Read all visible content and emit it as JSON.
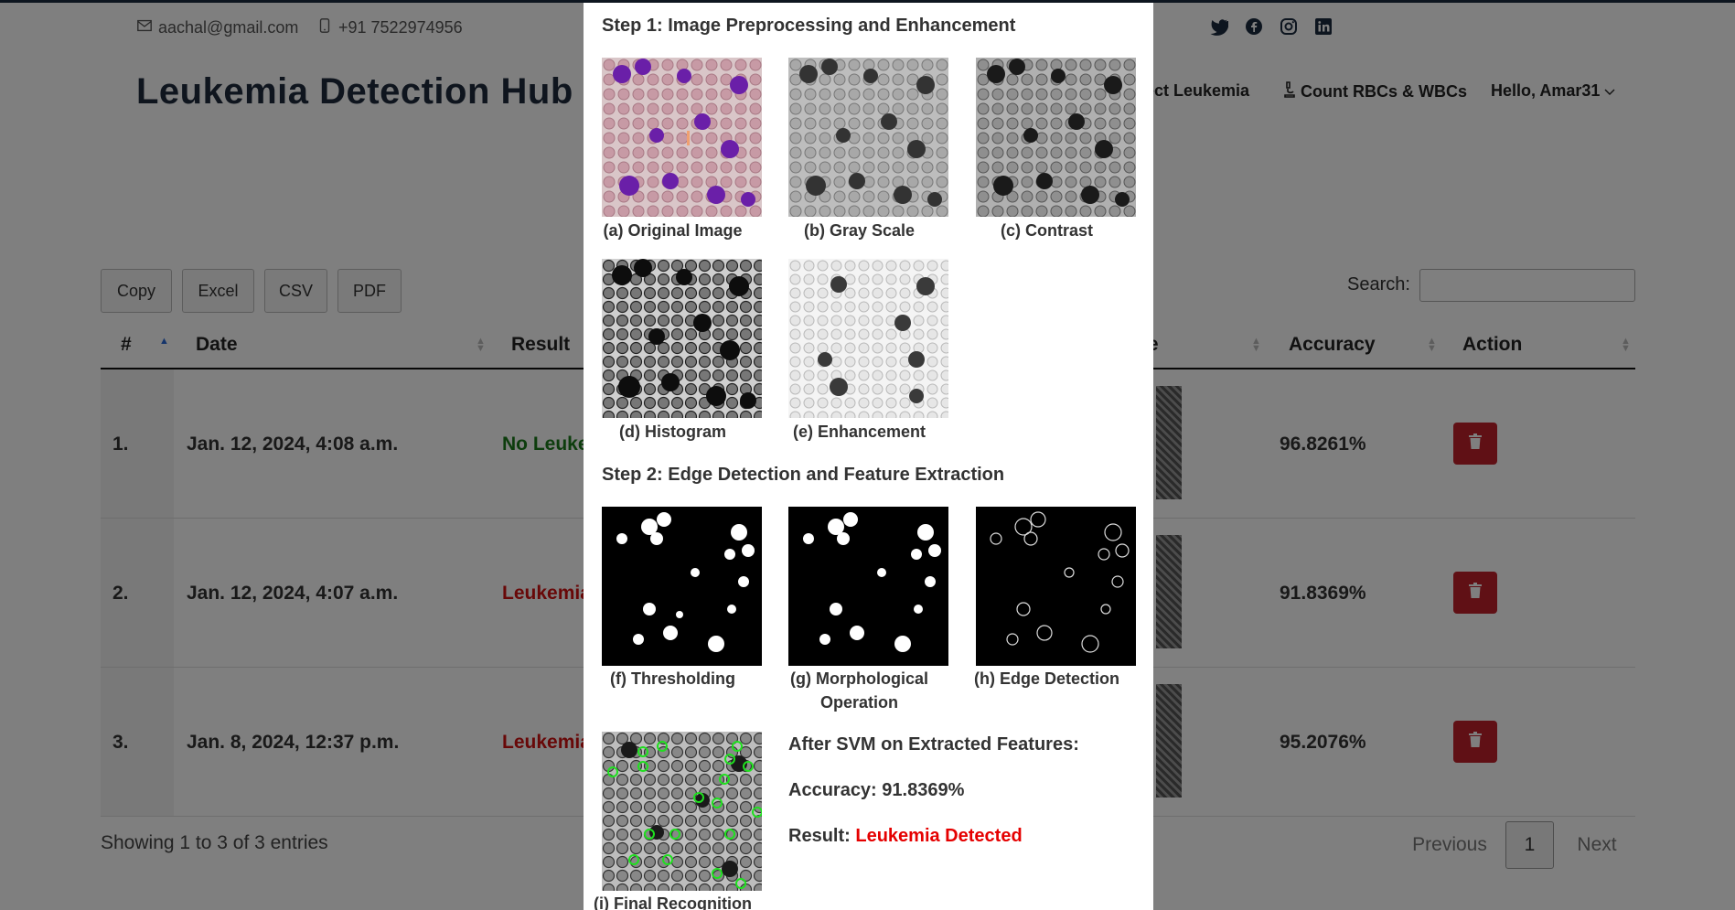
{
  "topbar": {
    "email": "aachal@gmail.com",
    "phone": "+91 7522974956",
    "social_icons": [
      "twitter-icon",
      "facebook-icon",
      "instagram-icon",
      "linkedin-icon"
    ]
  },
  "navbar": {
    "brand": "Leukemia Detection Hub",
    "items": [
      {
        "label": "ect Leukemia"
      },
      {
        "label": "Count RBCs & WBCs"
      },
      {
        "label": "Hello, Amar31"
      }
    ]
  },
  "table_controls": {
    "export_buttons": [
      "Copy",
      "Excel",
      "CSV",
      "PDF"
    ],
    "search_label": "Search:",
    "search_value": ""
  },
  "table": {
    "headers": [
      "#",
      "Date",
      "Result",
      "ge",
      "Accuracy",
      "Action"
    ],
    "rows": [
      {
        "num": "1.",
        "date": "Jan. 12, 2024, 4:08 a.m.",
        "result": "No Leuke",
        "result_color": "#1a7a1a",
        "accuracy": "96.8261%"
      },
      {
        "num": "2.",
        "date": "Jan. 12, 2024, 4:07 a.m.",
        "result": "Leukemia",
        "result_color": "#d01010",
        "accuracy": "91.8369%"
      },
      {
        "num": "3.",
        "date": "Jan. 8, 2024, 12:37 p.m.",
        "result": "Leukemia",
        "result_color": "#d01010",
        "accuracy": "95.2076%"
      }
    ],
    "footer_info": "Showing 1 to 3 of 3 entries",
    "pagination": {
      "previous": "Previous",
      "current": "1",
      "next": "Next"
    }
  },
  "modal": {
    "step1_title": "Step 1: Image Preprocessing and Enhancement",
    "step2_title": "Step 2: Edge Detection and Feature Extraction",
    "captions": {
      "a": "(a) Original Image",
      "b": "(b) Gray Scale",
      "c": "(c) Contrast",
      "d": "(d) Histogram",
      "e": "(e) Enhancement",
      "f": "(f) Thresholding",
      "g": "(g) Morphological Operation",
      "h": "(h) Edge Detection",
      "i": "(i) Final Recognition"
    },
    "svm_heading": "After SVM on Extracted Features:",
    "accuracy_label": "Accuracy:",
    "accuracy_value": "91.8369%",
    "result_label": "Result:",
    "result_value": "Leukemia Detected",
    "result_color": "#e50000"
  },
  "colors": {
    "brand": "#1e2b3c",
    "delete_button": "#c0202a",
    "overlay": "rgba(0,0,0,0.5)"
  }
}
